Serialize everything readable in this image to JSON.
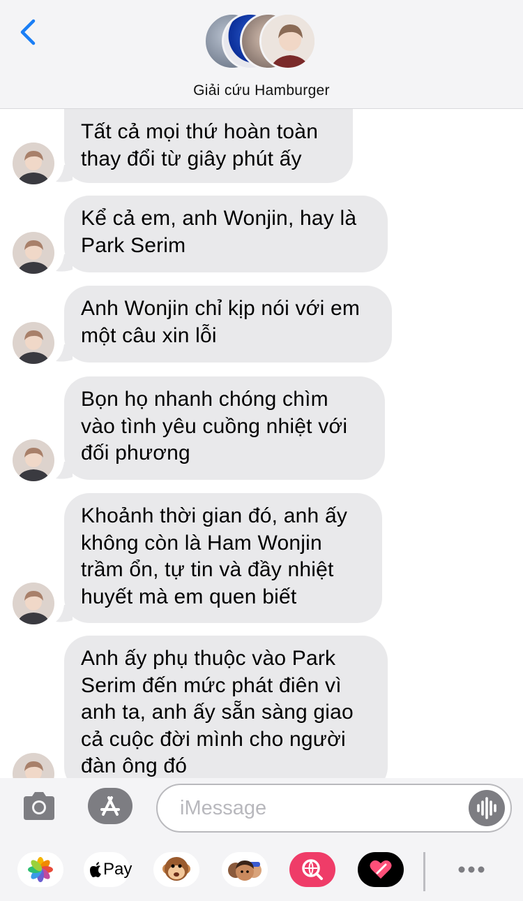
{
  "header": {
    "group_name": "Giải cứu Hamburger",
    "back_icon": "chevron-left-icon",
    "accent_color": "#1a7ef5"
  },
  "messages": [
    {
      "lines": [
        "Tất cả mọi thứ hoàn toàn",
        "thay đổi từ giây phút ấy"
      ]
    },
    {
      "lines": [
        "Kể cả em, anh Wonjin, hay là",
        "Park Serim"
      ]
    },
    {
      "lines": [
        "Anh Wonjin chỉ kịp nói với em",
        "một câu xin lỗi"
      ]
    },
    {
      "lines": [
        "Bọn họ nhanh chóng chìm",
        "vào tình yêu cuồng nhiệt với",
        "đối phương"
      ]
    },
    {
      "lines": [
        "Khoảnh thời gian đó, anh ấy",
        "không còn là Ham Wonjin",
        "trầm ổn, tự tin và đầy nhiệt",
        "huyết mà em quen biết"
      ]
    },
    {
      "lines": [
        "Anh ấy phụ thuộc vào Park",
        "Serim đến mức phát điên vì",
        "anh ta, anh ấy sẵn sàng giao",
        "cả cuộc đời mình cho người",
        "đàn ông đó"
      ]
    }
  ],
  "compose": {
    "placeholder": "iMessage",
    "camera_icon": "camera-icon",
    "apps_icon": "app-store-icon",
    "audio_icon": "waveform-icon"
  },
  "app_strip": {
    "apple_pay_label": "Pay",
    "icons": [
      "photos-icon",
      "apple-pay-icon",
      "animoji-icon",
      "memoji-icon",
      "web-search-icon",
      "digital-touch-icon",
      "more-icon"
    ]
  }
}
